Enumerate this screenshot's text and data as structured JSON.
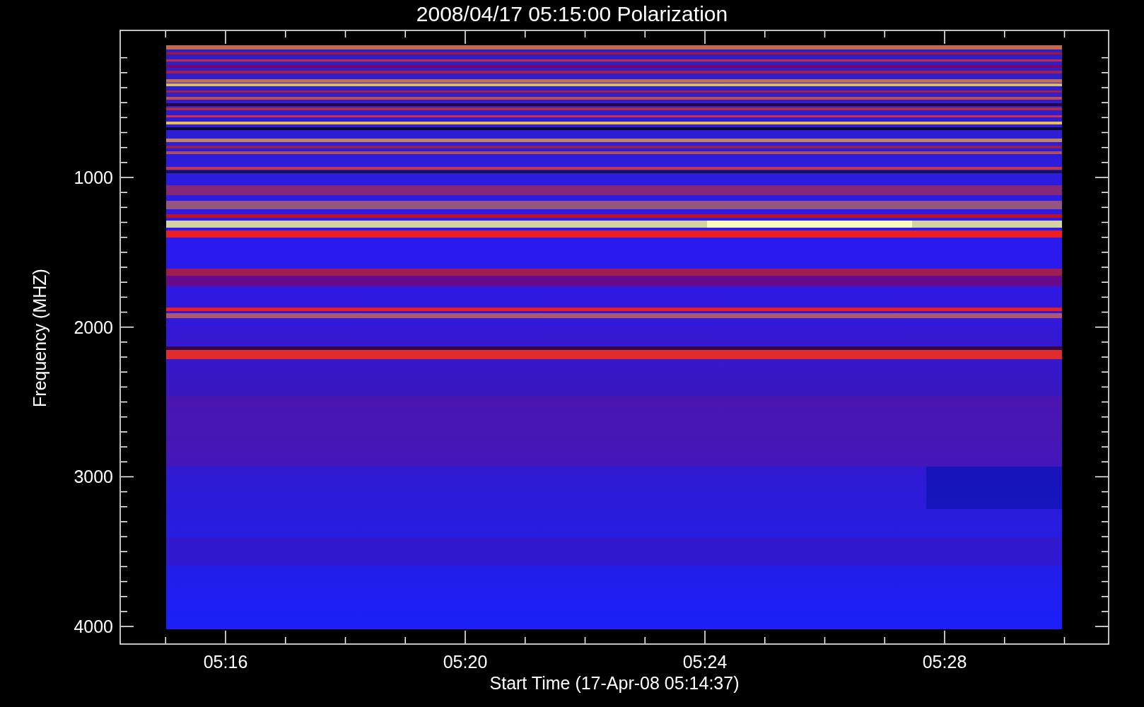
{
  "title": "2008/04/17 05:15:00 Polarization",
  "y_axis": {
    "label": "Frequency (MHZ)",
    "tick_labels": [
      "1000",
      "2000",
      "3000",
      "4000"
    ]
  },
  "x_axis": {
    "label": "Start Time (17-Apr-08 05:14:37)",
    "tick_labels": [
      "05:16",
      "05:20",
      "05:24",
      "05:28"
    ]
  }
}
